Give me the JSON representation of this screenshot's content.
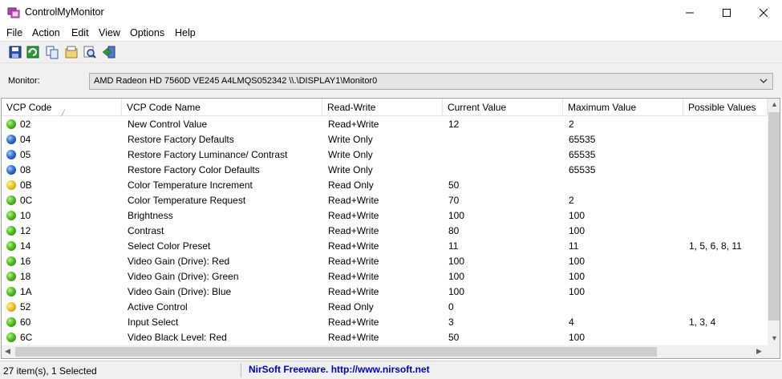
{
  "window": {
    "title": "ControlMyMonitor",
    "icon": "controlmymonitor-app-icon"
  },
  "menu": [
    "File",
    "Action",
    "Edit",
    "View",
    "Options",
    "Help"
  ],
  "toolbar": {
    "buttons": [
      "save-icon",
      "refresh-icon",
      "copy-icon",
      "properties-icon",
      "find-icon",
      "exit-icon"
    ]
  },
  "monitor": {
    "label": "Monitor:",
    "selected": "AMD Radeon HD 7560D  VE245  A4LMQS052342  \\\\.\\DISPLAY1\\Monitor0"
  },
  "columns": [
    "VCP Code",
    "VCP Code Name",
    "Read-Write",
    "Current Value",
    "Maximum Value",
    "Possible Values"
  ],
  "rows": [
    {
      "status": "rw",
      "code": "02",
      "name": "New Control Value",
      "rw": "Read+Write",
      "current": "12",
      "max": "2",
      "possible": ""
    },
    {
      "status": "wo",
      "code": "04",
      "name": "Restore Factory Defaults",
      "rw": "Write Only",
      "current": "",
      "max": "65535",
      "possible": ""
    },
    {
      "status": "wo",
      "code": "05",
      "name": "Restore Factory Luminance/ Contrast",
      "rw": "Write Only",
      "current": "",
      "max": "65535",
      "possible": ""
    },
    {
      "status": "wo",
      "code": "08",
      "name": "Restore Factory Color Defaults",
      "rw": "Write Only",
      "current": "",
      "max": "65535",
      "possible": ""
    },
    {
      "status": "ro",
      "code": "0B",
      "name": "Color Temperature Increment",
      "rw": "Read Only",
      "current": "50",
      "max": "",
      "possible": ""
    },
    {
      "status": "rw",
      "code": "0C",
      "name": "Color Temperature Request",
      "rw": "Read+Write",
      "current": "70",
      "max": "2",
      "possible": ""
    },
    {
      "status": "rw",
      "code": "10",
      "name": "Brightness",
      "rw": "Read+Write",
      "current": "100",
      "max": "100",
      "possible": ""
    },
    {
      "status": "rw",
      "code": "12",
      "name": "Contrast",
      "rw": "Read+Write",
      "current": "80",
      "max": "100",
      "possible": ""
    },
    {
      "status": "rw",
      "code": "14",
      "name": "Select Color Preset",
      "rw": "Read+Write",
      "current": "11",
      "max": "11",
      "possible": "1, 5, 6, 8, 11"
    },
    {
      "status": "rw",
      "code": "16",
      "name": "Video Gain (Drive): Red",
      "rw": "Read+Write",
      "current": "100",
      "max": "100",
      "possible": ""
    },
    {
      "status": "rw",
      "code": "18",
      "name": "Video Gain (Drive): Green",
      "rw": "Read+Write",
      "current": "100",
      "max": "100",
      "possible": ""
    },
    {
      "status": "rw",
      "code": "1A",
      "name": "Video Gain (Drive): Blue",
      "rw": "Read+Write",
      "current": "100",
      "max": "100",
      "possible": ""
    },
    {
      "status": "ro",
      "code": "52",
      "name": "Active Control",
      "rw": "Read Only",
      "current": "0",
      "max": "",
      "possible": ""
    },
    {
      "status": "rw",
      "code": "60",
      "name": "Input Select",
      "rw": "Read+Write",
      "current": "3",
      "max": "4",
      "possible": "1, 3, 4"
    },
    {
      "status": "rw",
      "code": "6C",
      "name": "Video Black Level: Red",
      "rw": "Read+Write",
      "current": "50",
      "max": "100",
      "possible": ""
    }
  ],
  "status": {
    "count": "27 item(s), 1 Selected",
    "link": "NirSoft Freeware.  http://www.nirsoft.net"
  }
}
